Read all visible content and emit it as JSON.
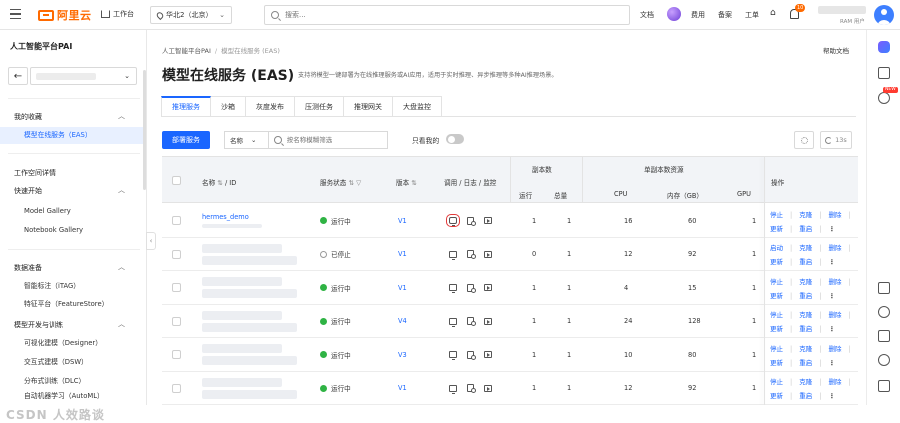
{
  "topbar": {
    "logo_text": "阿里云",
    "home_label": "工作台",
    "region": "华北2（北京）",
    "search_placeholder": "搜索...",
    "links": [
      "文档",
      "费用",
      "备案",
      "工单"
    ],
    "bell_badge": "10",
    "ram_label": "RAM 用户"
  },
  "sidebar": {
    "title": "人工智能平台PAI",
    "groups": [
      {
        "label": "我的收藏",
        "items": [
          "模型在线服务（EAS）"
        ]
      },
      {
        "label": "工作空间详情",
        "items": []
      },
      {
        "label": "快速开始",
        "items": [
          "Model Gallery",
          "Notebook Gallery"
        ]
      },
      {
        "label": "数据准备",
        "items": [
          "智能标注（iTAG）",
          "特征平台（FeatureStore）"
        ]
      },
      {
        "label": "模型开发与训练",
        "items": [
          "可视化建模（Designer）",
          "交互式建模（DSW）",
          "分布式训练（DLC）",
          "自动机器学习（AutoML）"
        ]
      }
    ],
    "watermark": "CSDN 人效路谈"
  },
  "main": {
    "breadcrumb": [
      "人工智能平台PAI",
      "模型在线服务 (EAS)"
    ],
    "help": "帮助文档",
    "title": "模型在线服务 (EAS)",
    "description": "支持将模型一键部署为在线推理服务或AI应用，适用于实时推理、异步推理等多种AI推理场景。",
    "tabs": [
      "推理服务",
      "沙箱",
      "灰度发布",
      "压测任务",
      "推理网关",
      "大盘监控"
    ],
    "deploy_button": "部署服务",
    "filter_field": "名称",
    "filter_placeholder": "按名称模糊筛选",
    "only_mine": "只看我的",
    "refresh_label": "13s"
  },
  "table": {
    "headers": {
      "name": "名称",
      "id": "/ ID",
      "status": "服务状态",
      "version": "版本",
      "call": "调用 / 日志 / 监控",
      "replicas": "副本数",
      "running": "运行",
      "total": "总量",
      "resources": "单副本数资源",
      "cpu": "CPU",
      "memory": "内存（GB）",
      "gpu": "GPU",
      "ops": "操作"
    },
    "rows": [
      {
        "name": "hermes_demo",
        "status": "运行中",
        "state": "run",
        "version": "V1",
        "running": "1",
        "total": "1",
        "cpu": "16",
        "memory": "60",
        "gpu": "1",
        "ops": [
          "停止",
          "克隆",
          "删除",
          "更新",
          "重启"
        ]
      },
      {
        "name": "",
        "status": "已停止",
        "state": "stop",
        "version": "V1",
        "running": "0",
        "total": "1",
        "cpu": "12",
        "memory": "92",
        "gpu": "1",
        "ops": [
          "启动",
          "克隆",
          "删除",
          "更新",
          "重启"
        ]
      },
      {
        "name": "",
        "status": "运行中",
        "state": "run",
        "version": "V1",
        "running": "1",
        "total": "1",
        "cpu": "4",
        "memory": "15",
        "gpu": "1",
        "ops": [
          "停止",
          "克隆",
          "删除",
          "更新",
          "重启"
        ]
      },
      {
        "name": "",
        "status": "运行中",
        "state": "run",
        "version": "V4",
        "running": "1",
        "total": "1",
        "cpu": "24",
        "memory": "128",
        "gpu": "1",
        "ops": [
          "停止",
          "克隆",
          "删除",
          "更新",
          "重启"
        ]
      },
      {
        "name": "",
        "status": "运行中",
        "state": "run",
        "version": "V3",
        "running": "1",
        "total": "1",
        "cpu": "10",
        "memory": "80",
        "gpu": "1",
        "ops": [
          "停止",
          "克隆",
          "删除",
          "更新",
          "重启"
        ]
      },
      {
        "name": "",
        "status": "运行中",
        "state": "run",
        "version": "V1",
        "running": "1",
        "total": "1",
        "cpu": "12",
        "memory": "92",
        "gpu": "1",
        "ops": [
          "停止",
          "克隆",
          "删除",
          "更新",
          "重启"
        ]
      }
    ]
  },
  "colors": {
    "accent": "#1a66ff",
    "brand": "#ff6a00",
    "running": "#2fb344",
    "highlight": "#e23a3a"
  }
}
